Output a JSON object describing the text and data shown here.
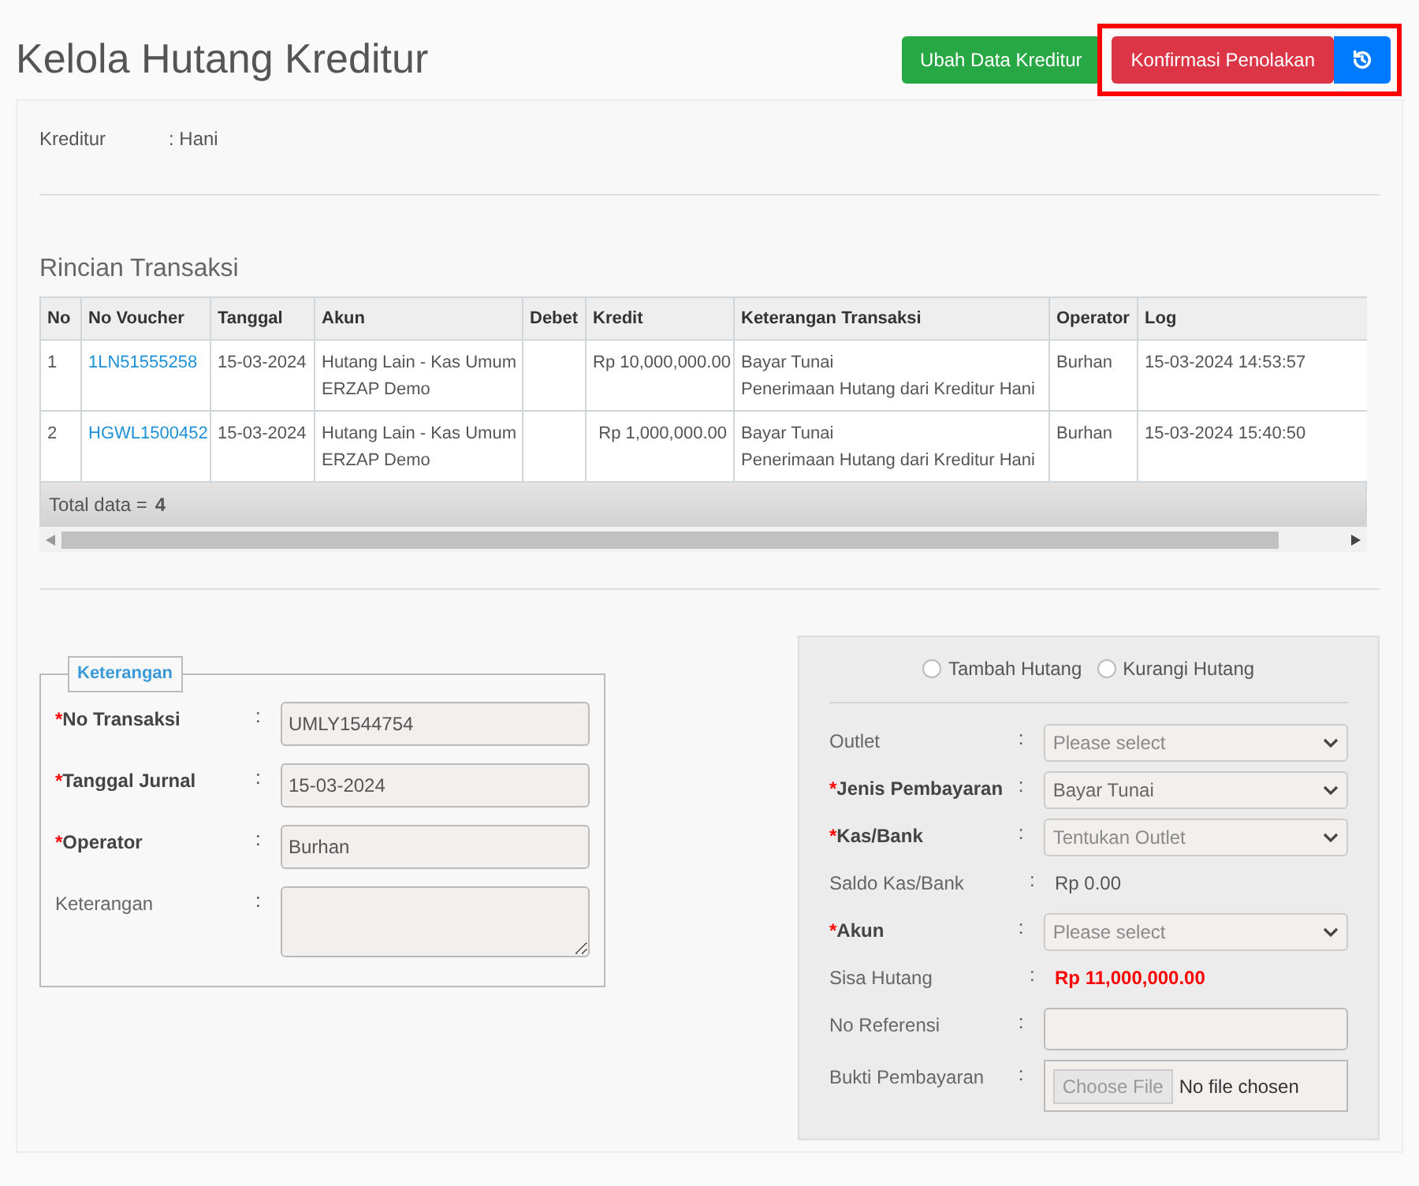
{
  "page": {
    "title": "Kelola Hutang Kreditur"
  },
  "actions": [
    {
      "kind": "text",
      "label": "Ubah Data Kreditur",
      "color": "#28a745"
    },
    {
      "kind": "text",
      "label": "Konfirmasi Penolakan",
      "color": "#dc3545"
    },
    {
      "kind": "icon",
      "color": "#007bff"
    }
  ],
  "creditor": {
    "label": "Kreditur",
    "value": ": Hani"
  },
  "transactions": {
    "title": "Rincian Transaksi",
    "columns": [
      "No",
      "No Voucher",
      "Tanggal",
      "Akun",
      "Debet",
      "Kredit",
      "Keterangan Transaksi",
      "Operator",
      "Log"
    ],
    "rows": [
      {
        "no": "1",
        "voucher": "1LN51555258",
        "date": "15-03-2024",
        "account": [
          "Hutang Lain - Kas Umum",
          "ERZAP Demo"
        ],
        "credit": "Rp 10,000,000.00",
        "description": [
          "Bayar Tunai",
          "Penerimaan Hutang dari Kreditur Hani"
        ],
        "operator": "Burhan",
        "log": "15-03-2024 14:53:57"
      },
      {
        "no": "2",
        "voucher": "HGWL1500452",
        "date": "15-03-2024",
        "account": [
          "Hutang Lain - Kas Umum",
          "ERZAP Demo"
        ],
        "credit": "Rp 1,000,000.00",
        "description": [
          "Bayar Tunai",
          "Penerimaan Hutang dari Kreditur Hani"
        ],
        "operator": "Burhan",
        "log": "15-03-2024 15:40:50"
      }
    ],
    "footer_label": "Total data =",
    "footer_count": "4"
  },
  "details": {
    "legend": "Keterangan",
    "fields": [
      {
        "kind": "input",
        "required": true,
        "mark": "*",
        "label": "No Transaksi",
        "separator": ":",
        "value": "UMLY1544754"
      },
      {
        "kind": "input",
        "required": true,
        "mark": "*",
        "label": "Tanggal Jurnal",
        "separator": ":",
        "value": "15-03-2024"
      },
      {
        "kind": "input",
        "required": true,
        "mark": "*",
        "label": "Operator",
        "separator": ":",
        "value": "Burhan"
      },
      {
        "kind": "textarea",
        "required": false,
        "label": "Keterangan",
        "separator": ":"
      }
    ]
  },
  "payment": {
    "options": [
      {
        "label": "Tambah Hutang",
        "selected": false
      },
      {
        "label": "Kurangi Hutang",
        "selected": false
      }
    ],
    "fields": [
      {
        "kind": "select",
        "required": false,
        "label": "Outlet",
        "separator": ":",
        "placeholder": "Please select"
      },
      {
        "kind": "select",
        "required": true,
        "mark": "*",
        "label": "Jenis Pembayaran",
        "separator": ":",
        "value": "Bayar Tunai"
      },
      {
        "kind": "select",
        "required": true,
        "mark": "*",
        "label": "Kas/Bank",
        "separator": ":",
        "placeholder": "Tentukan Outlet"
      },
      {
        "kind": "text",
        "required": false,
        "label": "Saldo Kas/Bank",
        "separator": ":",
        "value": "Rp 0.00"
      },
      {
        "kind": "select",
        "required": true,
        "mark": "*",
        "label": "Akun",
        "separator": ":",
        "placeholder": "Please select"
      },
      {
        "kind": "alert",
        "required": false,
        "label": "Sisa Hutang",
        "separator": ":",
        "value": "Rp 11,000,000.00"
      },
      {
        "kind": "input",
        "required": false,
        "label": "No Referensi",
        "separator": ":"
      },
      {
        "kind": "file",
        "required": false,
        "label": "Bukti Pembayaran",
        "separator": ":",
        "button": "Choose File",
        "value": "No file chosen"
      }
    ]
  }
}
